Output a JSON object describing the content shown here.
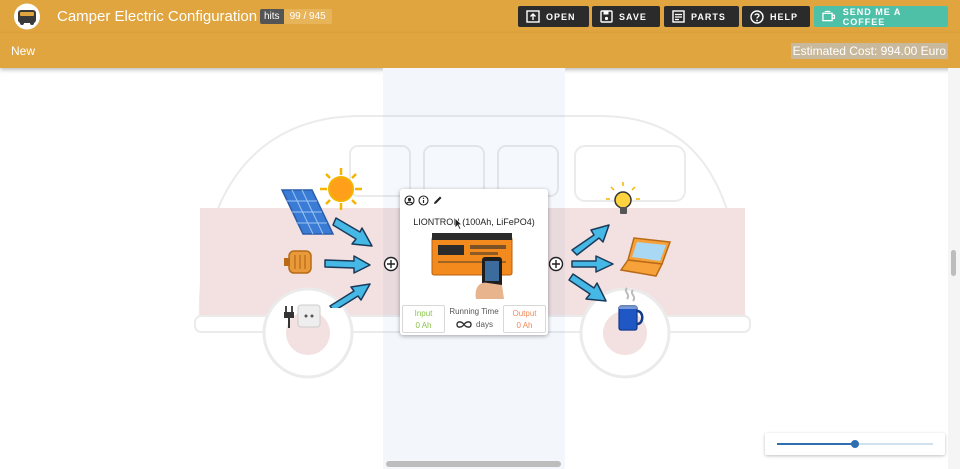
{
  "header": {
    "title": "Camper Electric Configuration",
    "hits_label": "hits",
    "hits_value": "99 / 945",
    "buttons": {
      "open": "OPEN",
      "save": "SAVE",
      "parts": "PARTS",
      "help": "HELP",
      "coffee": "SEND ME A COFFEE"
    }
  },
  "subbar": {
    "config_name": "New",
    "estimated_cost": "Estimated Cost: 994.00 Euro"
  },
  "battery": {
    "name": "LIONTRON (100Ah, LiFePO4)",
    "input_label": "Input",
    "input_value": "0 Ah",
    "runtime_label": "Running Time",
    "runtime_value": "days",
    "output_label": "Output",
    "output_value": "0 Ah"
  },
  "zoom_slider": {
    "fraction": 0.5
  },
  "colors": {
    "header_bg": "#e0a53e",
    "toolbar_button": "#2b2b2b",
    "coffee_button": "#4fc0a8",
    "arrow_fill": "#45b8e6",
    "slider_accent": "#2f6fb0"
  }
}
